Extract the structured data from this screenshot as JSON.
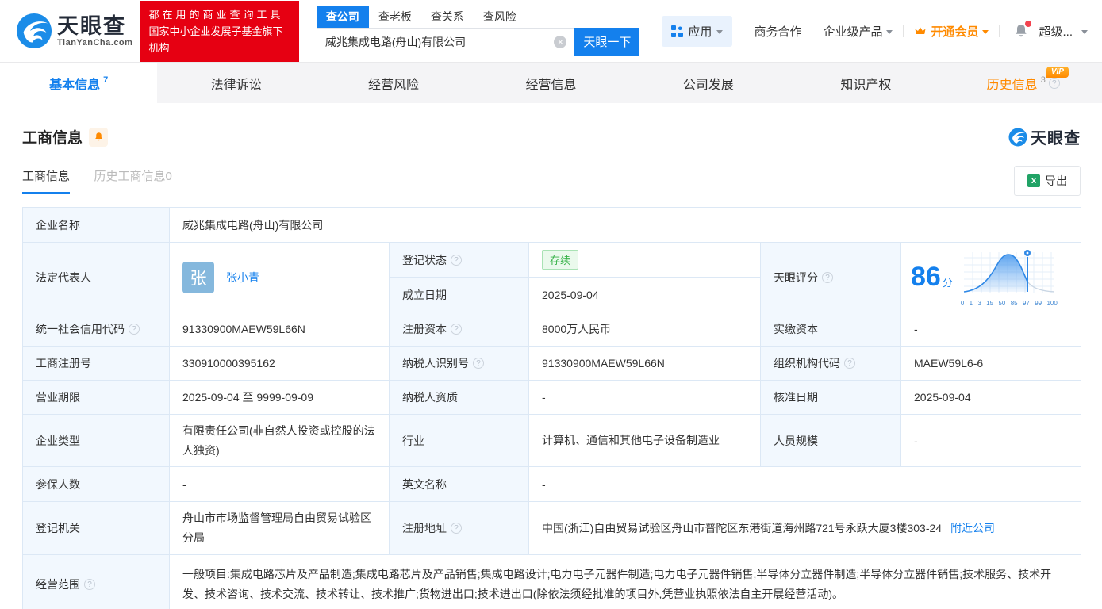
{
  "header": {
    "logo": {
      "cn": "天眼查",
      "en": "TianYanCha.com"
    },
    "slogan": {
      "line1": "都在用的商业查询工具",
      "line2": "国家中小企业发展子基金旗下机构"
    },
    "search": {
      "tabs": [
        {
          "label": "查公司",
          "active": true
        },
        {
          "label": "查老板",
          "active": false
        },
        {
          "label": "查关系",
          "active": false
        },
        {
          "label": "查风险",
          "active": false
        }
      ],
      "value": "威兆集成电路(舟山)有限公司",
      "button": "天眼一下"
    },
    "nav": {
      "apps": "应用",
      "cooperation": "商务合作",
      "enterprise": "企业级产品",
      "vip": "开通会员",
      "account": "超级..."
    }
  },
  "tabs": [
    {
      "label": "基本信息",
      "count": "7",
      "active": true
    },
    {
      "label": "法律诉讼"
    },
    {
      "label": "经营风险"
    },
    {
      "label": "经营信息"
    },
    {
      "label": "公司发展"
    },
    {
      "label": "知识产权"
    },
    {
      "label": "历史信息",
      "count": "3",
      "vip_badge": "VIP"
    }
  ],
  "section": {
    "title": "工商信息",
    "watermark": "天眼查",
    "subtabs": [
      {
        "label": "工商信息",
        "active": true
      },
      {
        "label": "历史工商信息0",
        "active": false
      }
    ],
    "export_label": "导出"
  },
  "table": {
    "company_name": {
      "label": "企业名称",
      "value": "威兆集成电路(舟山)有限公司"
    },
    "legal_rep": {
      "label": "法定代表人",
      "avatar": "张",
      "name": "张小青"
    },
    "reg_status": {
      "label": "登记状态",
      "value": "存续"
    },
    "establish_date": {
      "label": "成立日期",
      "value": "2025-09-04"
    },
    "score": {
      "label": "天眼评分",
      "value": "86",
      "unit": "分",
      "axis": [
        "0",
        "1",
        "3",
        "15",
        "50",
        "85",
        "97",
        "99",
        "100"
      ]
    },
    "credit_code": {
      "label": "统一社会信用代码",
      "value": "91330900MAEW59L66N"
    },
    "reg_capital": {
      "label": "注册资本",
      "value": "8000万人民币"
    },
    "paid_capital": {
      "label": "实缴资本",
      "value": "-"
    },
    "reg_number": {
      "label": "工商注册号",
      "value": "330910000395162"
    },
    "taxpayer_id": {
      "label": "纳税人识别号",
      "value": "91330900MAEW59L66N"
    },
    "org_code": {
      "label": "组织机构代码",
      "value": "MAEW59L6-6"
    },
    "business_term": {
      "label": "营业期限",
      "value": "2025-09-04 至 9999-09-09"
    },
    "taxpayer_quality": {
      "label": "纳税人资质",
      "value": "-"
    },
    "approval_date": {
      "label": "核准日期",
      "value": "2025-09-04"
    },
    "company_type": {
      "label": "企业类型",
      "value": "有限责任公司(非自然人投资或控股的法人独资)"
    },
    "industry": {
      "label": "行业",
      "value": "计算机、通信和其他电子设备制造业"
    },
    "staff_size": {
      "label": "人员规模",
      "value": "-"
    },
    "insured_count": {
      "label": "参保人数",
      "value": "-"
    },
    "english_name": {
      "label": "英文名称",
      "value": "-"
    },
    "reg_authority": {
      "label": "登记机关",
      "value": "舟山市市场监督管理局自由贸易试验区分局"
    },
    "reg_address": {
      "label": "注册地址",
      "value": "中国(浙江)自由贸易试验区舟山市普陀区东港街道海州路721号永跃大厦3楼303-24",
      "nearby_link": "附近公司"
    },
    "business_scope": {
      "label": "经营范围",
      "value": "一般项目:集成电路芯片及产品制造;集成电路芯片及产品销售;集成电路设计;电力电子元器件制造;电力电子元器件销售;半导体分立器件制造;半导体分立器件销售;技术服务、技术开发、技术咨询、技术交流、技术转让、技术推广;货物进出口;技术进出口(除依法须经批准的项目外,凭营业执照依法自主开展经营活动)。"
    }
  },
  "icons": {
    "help": "?",
    "clear": "×",
    "excel": "x",
    "chevron-down": "▾",
    "bell": "bell-shape",
    "crown": "crown-shape",
    "apps-grid": "grid-squares",
    "logo-swirl": "eye-swirl",
    "score-pin": "map-pin"
  },
  "colors": {
    "brand_blue": "#1480ed",
    "brand_red": "#e60012",
    "vip_orange": "#ff8a00",
    "status_green": "#39b34a",
    "label_bg": "#f2f8fe",
    "border": "#dce8f5"
  }
}
